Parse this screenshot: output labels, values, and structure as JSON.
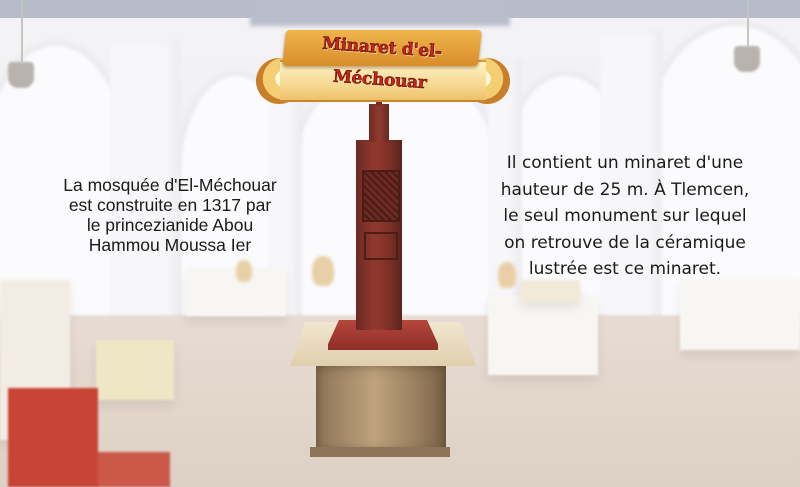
{
  "title": "Minaret d'el-Méchouar",
  "captions": {
    "left": [
      "La mosquée d'El-Méchouar",
      "est construite en 1317  par",
      "le princezianide Abou",
      "Hammou Moussa Ier"
    ],
    "right": [
      "Il contient un minaret d'une",
      "hauteur de 25 m. À Tlemcen,",
      "le seul monument sur lequel",
      "on retrouve de la céramique",
      "lustrée est ce minaret."
    ]
  },
  "colors": {
    "banner": "#f0b54c",
    "title_text": "#c8231c",
    "minaret": "#93392e"
  }
}
